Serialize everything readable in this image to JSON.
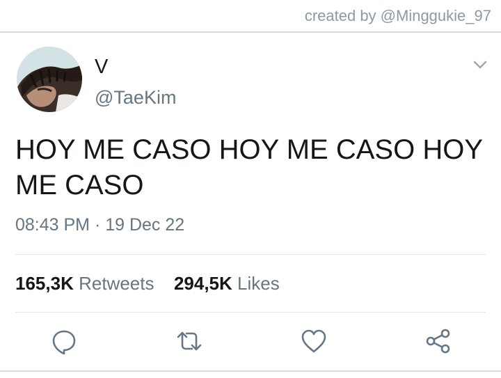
{
  "credit_text": "created by @Minggukie_97",
  "tweet": {
    "display_name": "V",
    "handle": "@TaeKim",
    "text": "HOY ME CASO HOY ME CASO HOY ME CASO",
    "timestamp": "08:43 PM · 19 Dec 22",
    "retweets_count": "165,3K",
    "retweets_label": "Retweets",
    "likes_count": "294,5K",
    "likes_label": "Likes"
  },
  "icons": {
    "avatar": "avatar",
    "menu": "chevron-down-icon",
    "reply": "reply-icon",
    "retweet": "retweet-icon",
    "like": "heart-icon",
    "share": "share-icon"
  },
  "colors": {
    "text_primary": "#14171a",
    "text_secondary": "#66757f",
    "icon": "#657786",
    "divider": "#e1e8ed"
  }
}
